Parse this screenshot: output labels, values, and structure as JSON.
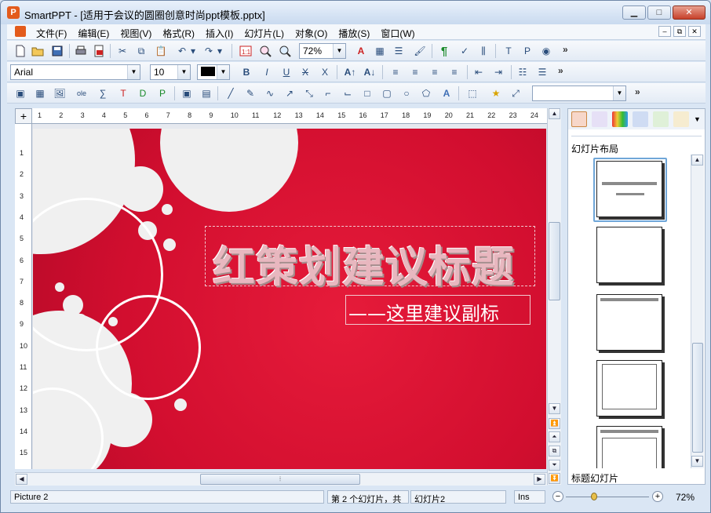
{
  "window": {
    "title": "SmartPPT - [适用于会议的圆圈创意时尚ppt模板.pptx]",
    "logo_letter": "P",
    "min_label": "▁",
    "max_label": "□",
    "close_label": "✕"
  },
  "menu": {
    "items": [
      "文件(F)",
      "编辑(E)",
      "视图(V)",
      "格式(R)",
      "插入(I)",
      "幻灯片(L)",
      "对象(O)",
      "播放(S)",
      "窗口(W)"
    ]
  },
  "toolbar": {
    "zoom_value": "72%",
    "font_name": "Arial",
    "font_size": "10",
    "more": "»"
  },
  "slide": {
    "title": "红策划建议标题",
    "subtitle": "——这里建议副标"
  },
  "ruler": {
    "h_numbers": [
      "1",
      "2",
      "3",
      "4",
      "5",
      "6",
      "7",
      "8",
      "9",
      "10",
      "11",
      "12",
      "13",
      "14",
      "15",
      "16",
      "17",
      "18",
      "19",
      "20",
      "21",
      "22",
      "23",
      "24"
    ],
    "v_numbers": [
      "1",
      "2",
      "3",
      "4",
      "5",
      "6",
      "7",
      "8",
      "9",
      "10",
      "11",
      "12",
      "13",
      "14",
      "15"
    ]
  },
  "panel": {
    "heading": "幻灯片布局",
    "footer": "标题幻灯片"
  },
  "status": {
    "object": "Picture 2",
    "slide_info": "第 2 个幻灯片，共",
    "slide_name": "幻灯片2",
    "mode": "Ins",
    "zoom": "72%",
    "zoom_level_pct": 72
  },
  "colors": {
    "slide_red": "#d20e2f",
    "accent_blue": "#6fa6d8"
  }
}
